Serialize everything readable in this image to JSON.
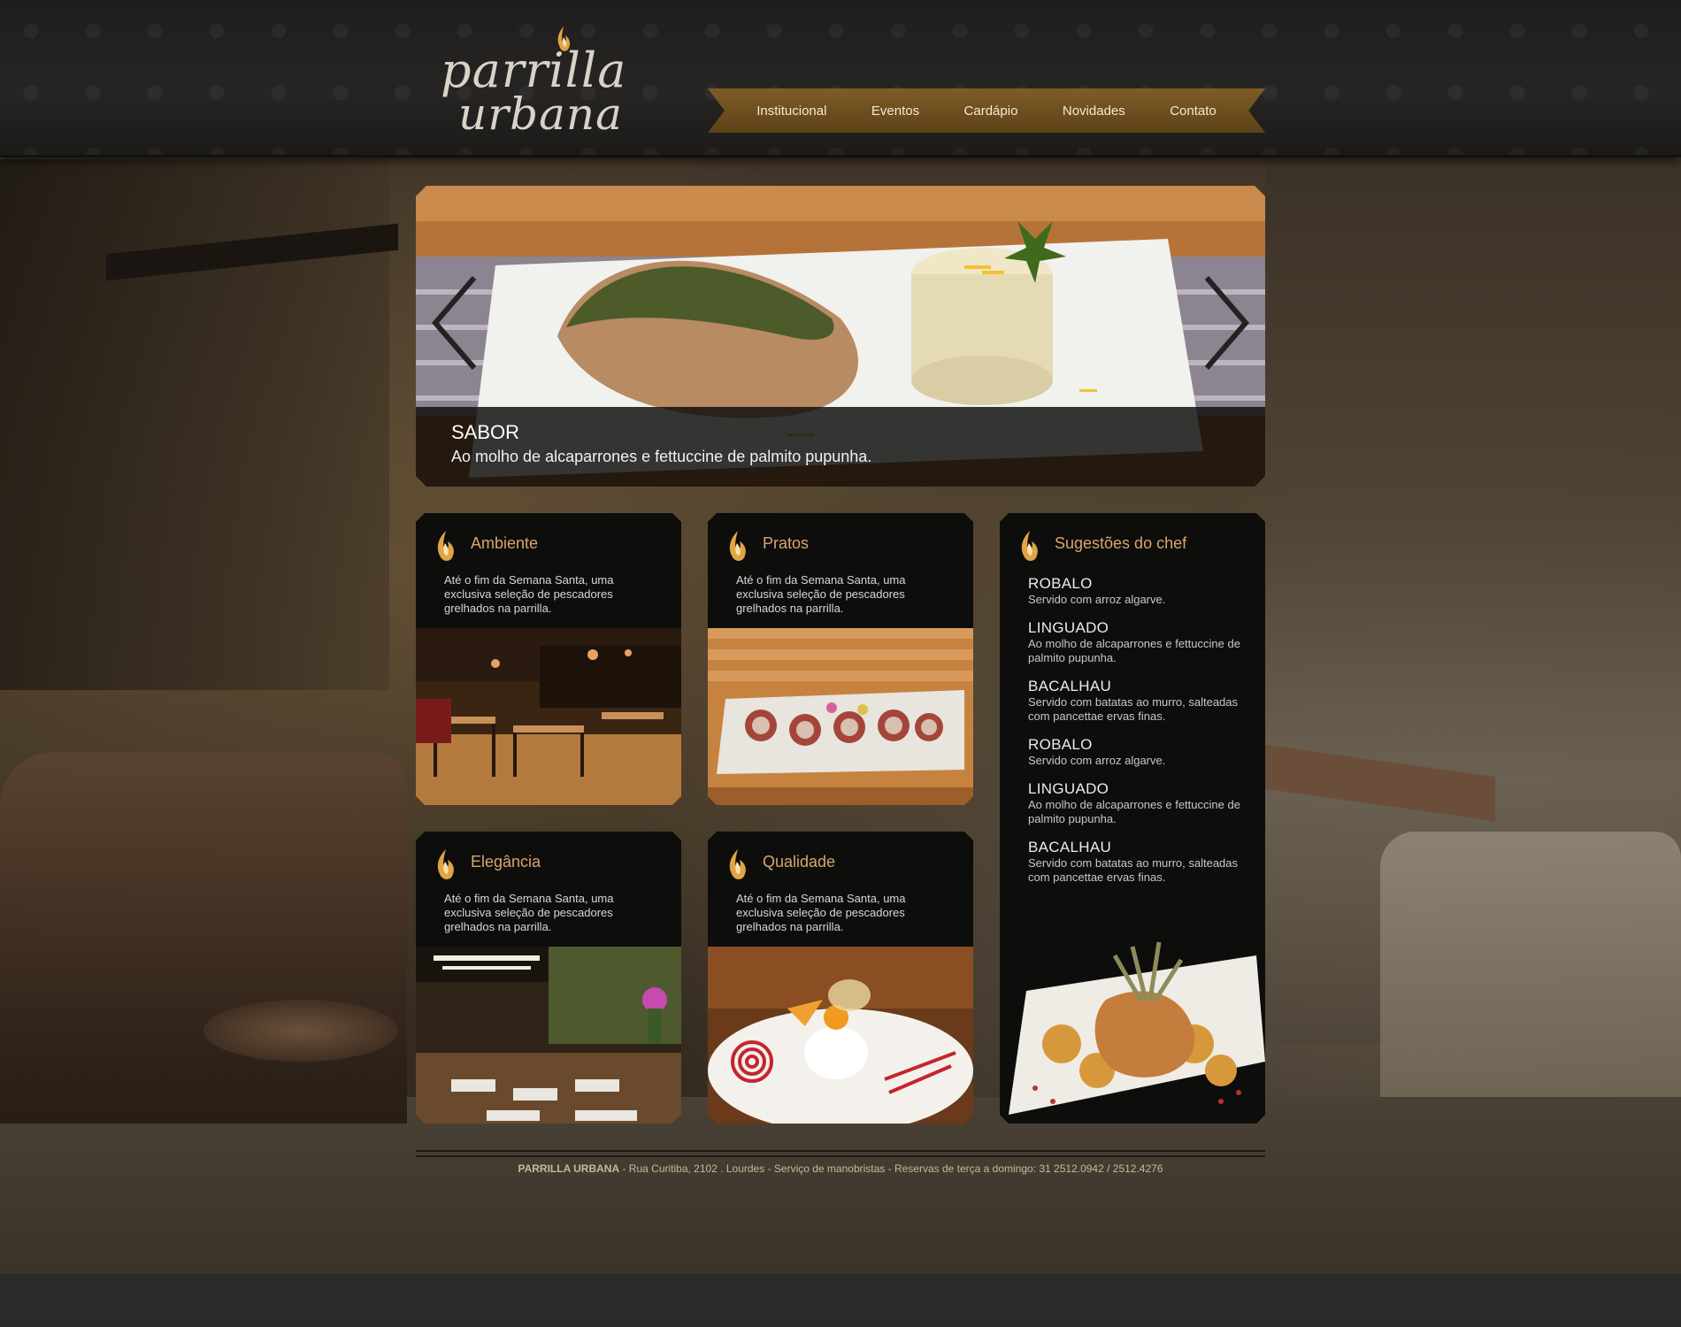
{
  "brand": {
    "line1": "parrilla",
    "line2": "urbana"
  },
  "nav": {
    "items": [
      {
        "label": "Institucional"
      },
      {
        "label": "Eventos"
      },
      {
        "label": "Cardápio"
      },
      {
        "label": "Novidades"
      },
      {
        "label": "Contato"
      }
    ]
  },
  "slider": {
    "title": "SABOR",
    "subtitle": "Ao molho de alcaparrones e fettuccine de palmito pupunha."
  },
  "cards": [
    {
      "title": "Ambiente",
      "text": "Até o fim da Semana Santa, uma exclusiva seleção de pescadores grelhados na parrilla."
    },
    {
      "title": "Pratos",
      "text": "Até o fim da Semana Santa, uma exclusiva seleção de pescadores grelhados na parrilla."
    },
    {
      "title": "Elegância",
      "text": "Até o fim da Semana Santa, uma exclusiva seleção de pescadores grelhados na parrilla."
    },
    {
      "title": "Qualidade",
      "text": "Até o fim da Semana Santa, uma exclusiva seleção de pescadores grelhados na parrilla."
    }
  ],
  "chef": {
    "title": "Sugestões do chef",
    "items": [
      {
        "name": "ROBALO",
        "desc": "Servido com arroz algarve."
      },
      {
        "name": "LINGUADO",
        "desc": "Ao molho de alcaparrones e fettuccine de palmito pupunha."
      },
      {
        "name": "BACALHAU",
        "desc": "Servido com batatas ao murro, salteadas com pancettae ervas finas."
      },
      {
        "name": "ROBALO",
        "desc": "Servido com arroz algarve."
      },
      {
        "name": "LINGUADO",
        "desc": "Ao molho de alcaparrones e fettuccine de palmito pupunha."
      },
      {
        "name": "BACALHAU",
        "desc": "Servido com batatas ao murro, salteadas com pancettae ervas finas."
      }
    ]
  },
  "footer": {
    "brand": "PARRILLA URBANA",
    "text": " - Rua Curitiba, 2102 . Lourdes - Serviço de manobristas - Reservas de terça a domingo: 31 2512.0942 / 2512.4276"
  },
  "colors": {
    "accent": "#d9a66a",
    "nav_bg": "#6e4f1f",
    "card_bg": "#0d0d0c",
    "footer_text": "#c9b89c"
  },
  "icons": {
    "slider_prev": "chevron-left-icon",
    "slider_next": "chevron-right-icon",
    "card": "flame-icon"
  }
}
